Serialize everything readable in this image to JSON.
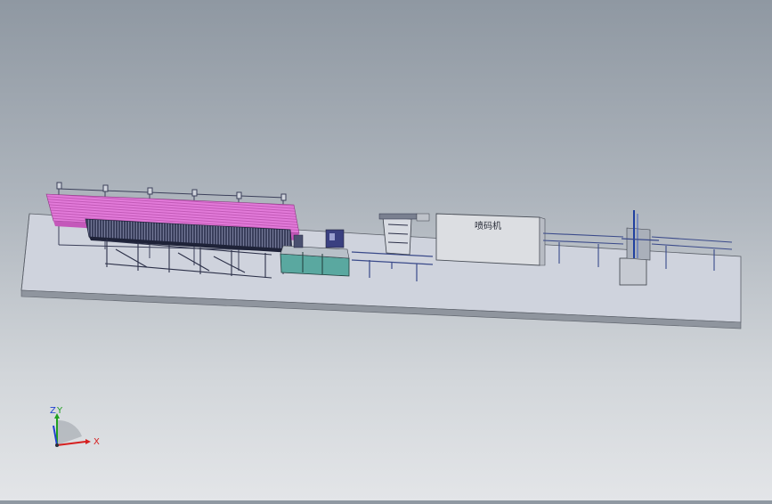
{
  "viewport": {
    "machine_label": "喷码机",
    "triad": {
      "x_label": "X",
      "y_label": "Y",
      "z_label": "Z"
    }
  },
  "colors": {
    "background_top": "#8f98a2",
    "background_bottom": "#e3e5e8",
    "platform_top": "#cfd3dd",
    "platform_side": "#9aa0a8",
    "stock_magenta": "#e070d8",
    "frame_dark": "#2a2e4a",
    "conveyor_blue": "#3a4a8a",
    "teal_panel": "#5aa8a0",
    "printer_box": "#dcdee2",
    "x_axis": "#d62020",
    "y_axis": "#20a020",
    "z_axis": "#2040d0"
  }
}
